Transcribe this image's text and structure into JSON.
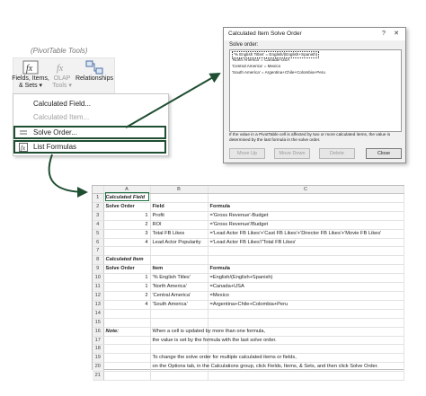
{
  "ribbon": {
    "group_title": "(PivotTable Tools)",
    "fields_button": {
      "line1": "Fields, Items,",
      "line2": "& Sets ▾",
      "icon": "fx-icon"
    },
    "olap_button": {
      "line1": "OLAP",
      "line2": "Tools ▾",
      "icon": "fx-olap-icon"
    },
    "relationships_button": {
      "label": "Relationships",
      "icon": "relationships-icon"
    }
  },
  "menu": {
    "items": [
      {
        "label": "Calculated Field...",
        "enabled": true
      },
      {
        "label": "Calculated Item...",
        "enabled": false
      },
      {
        "label": "Solve Order...",
        "enabled": true
      },
      {
        "label": "List Formulas",
        "enabled": true
      }
    ]
  },
  "dialog": {
    "title": "Calculated Item Solve Order",
    "solve_order_label": "Solve order:",
    "rows": [
      "'% English Titles' = English/(English+Spanish)",
      "'North America' = Canada+USA",
      "'Central America' = Mexico",
      "'South America' = Argentina+Chile+Colombia+Peru"
    ],
    "note": "If the value in a PivotTable cell is affected by two or more calculated items, the value is determined by the last formula in the solve order.",
    "buttons": {
      "move_up": "Move Up",
      "move_down": "Move Down",
      "delete": "Delete",
      "close": "Close"
    },
    "help": "?",
    "close_x": "✕"
  },
  "sheet": {
    "columns": [
      "A",
      "B",
      "C"
    ],
    "rows": [
      {
        "n": "1",
        "a": "Calculated Field",
        "b": "",
        "c": ""
      },
      {
        "n": "2",
        "a": "Solve Order",
        "b": "Field",
        "c": "Formula"
      },
      {
        "n": "3",
        "a": "1",
        "b": "Profit",
        "c": "='Gross Revenue'-Budget"
      },
      {
        "n": "4",
        "a": "2",
        "b": "ROI",
        "c": "='Gross Revenue'/Budget"
      },
      {
        "n": "5",
        "a": "3",
        "b": "Total FB Likes",
        "c": "='Lead Actor FB Likes'+'Cast FB Likes'+'Director FB Likes'+'Movie FB Likes'"
      },
      {
        "n": "6",
        "a": "4",
        "b": "Lead Actor Popularity",
        "c": "='Lead Actor FB Likes'/'Total FB Likes'"
      },
      {
        "n": "7",
        "a": "",
        "b": "",
        "c": ""
      },
      {
        "n": "8",
        "a": "Calculated Item",
        "b": "",
        "c": ""
      },
      {
        "n": "9",
        "a": "Solve Order",
        "b": "Item",
        "c": "Formula"
      },
      {
        "n": "10",
        "a": "1",
        "b": "'% English Titles'",
        "c": "=English/(English+Spanish)"
      },
      {
        "n": "11",
        "a": "1",
        "b": "'North America'",
        "c": "=Canada+USA"
      },
      {
        "n": "12",
        "a": "2",
        "b": "'Central America'",
        "c": "=Mexico"
      },
      {
        "n": "13",
        "a": "4",
        "b": "'South America'",
        "c": "=Argentina+Chile+Colombia+Peru"
      },
      {
        "n": "14",
        "a": "",
        "b": "",
        "c": ""
      },
      {
        "n": "15",
        "a": "",
        "b": "",
        "c": ""
      },
      {
        "n": "16",
        "a": "Note:",
        "b": "When a cell is updated by more than one formula,",
        "c": ""
      },
      {
        "n": "17",
        "a": "",
        "b": "the value is set by the formula with the last solve order.",
        "c": ""
      },
      {
        "n": "18",
        "a": "",
        "b": "",
        "c": ""
      },
      {
        "n": "19",
        "a": "",
        "b": "To change the solve order for multiple calculated items or fields,",
        "c": ""
      },
      {
        "n": "20",
        "a": "",
        "b": "on the Options tab, in the Calculations group, click Fields, Items, & Sets, and then click Solve Order.",
        "c": ""
      },
      {
        "n": "21",
        "a": "",
        "b": "",
        "c": ""
      }
    ]
  },
  "colors": {
    "highlight": "#1f4e32",
    "selection": "#217346"
  }
}
